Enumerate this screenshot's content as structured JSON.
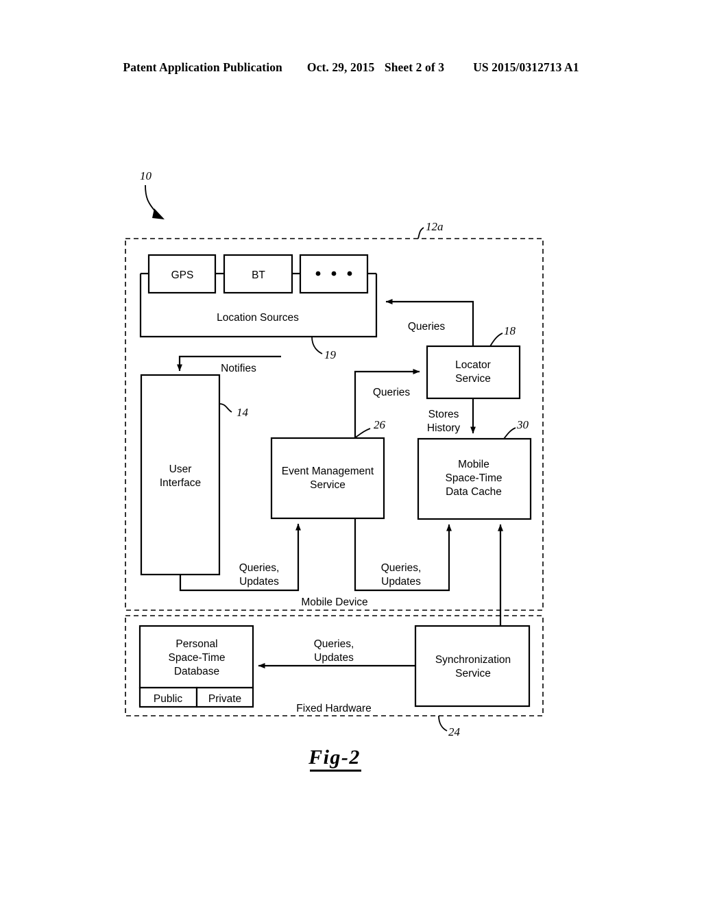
{
  "header": {
    "left": "Patent Application Publication",
    "date": "Oct. 29, 2015",
    "sheet": "Sheet 2 of 3",
    "right": "US 2015/0312713 A1"
  },
  "figure": {
    "caption": "Fig-2"
  },
  "zones": [
    {
      "id": "mobile-device",
      "label": "Mobile Device",
      "ref": "12a"
    },
    {
      "id": "fixed-hardware",
      "label": "Fixed Hardware",
      "ref": "24"
    }
  ],
  "blocks": {
    "system_ref": "10",
    "gps": {
      "label": "GPS"
    },
    "bt": {
      "label": "BT"
    },
    "ellipsis": {
      "label": "• • •"
    },
    "location_sources": {
      "label": "Location Sources",
      "ref": "19"
    },
    "user_interface": {
      "line1": "User",
      "line2": "Interface",
      "ref": "14"
    },
    "event_management_service": {
      "line1": "Event Management",
      "line2": "Service",
      "ref": "26"
    },
    "locator_service": {
      "line1": "Locator",
      "line2": "Service",
      "ref": "18"
    },
    "mobile_cache": {
      "line1": "Mobile",
      "line2": "Space-Time",
      "line3": "Data Cache",
      "ref": "30"
    },
    "personal_db": {
      "line1": "Personal",
      "line2": "Space-Time",
      "line3": "Database",
      "public": "Public",
      "private": "Private"
    },
    "sync_service": {
      "line1": "Synchronization",
      "line2": "Service"
    }
  },
  "flows": {
    "queries_to_sources": "Queries",
    "notifies": "Notifies",
    "queries_to_locator": "Queries",
    "stores_history_1": "Stores",
    "stores_history_2": "History",
    "ui_queries_1": "Queries,",
    "ui_queries_2": "Updates",
    "ems_queries_1": "Queries,",
    "ems_queries_2": "Updates",
    "sync_queries_1": "Queries,",
    "sync_queries_2": "Updates"
  },
  "colors": {
    "ink": "#000000",
    "paper": "#ffffff"
  }
}
